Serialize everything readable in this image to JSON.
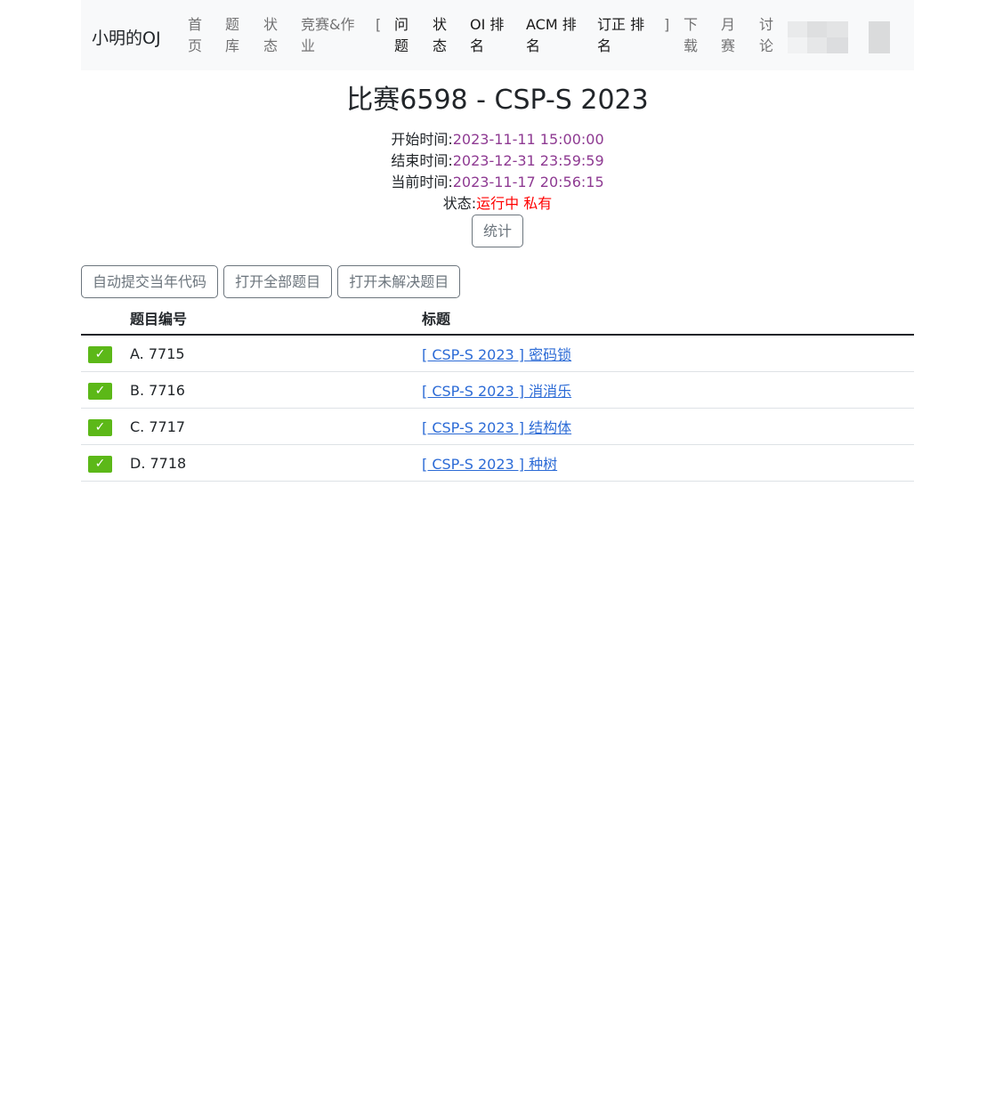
{
  "nav": {
    "brand": "小明的OJ",
    "items": [
      {
        "l1": "首",
        "l2": "页"
      },
      {
        "l1": "题",
        "l2": "库"
      },
      {
        "l1": "状",
        "l2": "态"
      },
      {
        "l1": "竞赛&作",
        "l2": "业"
      }
    ],
    "bracket_open": "[",
    "contest_items": [
      {
        "l1": "问",
        "l2": "题"
      },
      {
        "l1": "状",
        "l2": "态"
      },
      {
        "l1": "OI 排",
        "l2": "名"
      },
      {
        "l1": "ACM 排",
        "l2": "名"
      },
      {
        "l1": "订正 排",
        "l2": "名"
      }
    ],
    "bracket_close": "]",
    "right_items": [
      {
        "l1": "下",
        "l2": "载"
      },
      {
        "l1": "月",
        "l2": "赛"
      },
      {
        "l1": "讨",
        "l2": "论"
      }
    ]
  },
  "contest": {
    "title": "比赛6598 - CSP-S 2023",
    "start_label": "开始时间:",
    "start_time": "2023-11-11 15:00:00",
    "end_label": "结束时间:",
    "end_time": "2023-12-31 23:59:59",
    "now_label": "当前时间:",
    "now_time": "2023-11-17 20:56:15",
    "status_label": "状态:",
    "status_value": "运行中 私有",
    "stats_button": "统计"
  },
  "actions": {
    "auto_submit": "自动提交当年代码",
    "open_all": "打开全部题目",
    "open_unsolved": "打开未解决题目"
  },
  "table": {
    "headers": {
      "id": "题目编号",
      "title": "标题"
    },
    "rows": [
      {
        "check": "✓",
        "id": "A. 7715",
        "title": "[ CSP-S 2023 ] 密码锁"
      },
      {
        "check": "✓",
        "id": "B. 7716",
        "title": "[ CSP-S 2023 ] 消消乐"
      },
      {
        "check": "✓",
        "id": "C. 7717",
        "title": "[ CSP-S 2023 ] 结构体"
      },
      {
        "check": "✓",
        "id": "D. 7718",
        "title": "[ CSP-S 2023 ] 种树"
      }
    ]
  },
  "colors": {
    "info_value": "#8e3a92",
    "status_value": "#ff0000",
    "solved_badge": "#5cb818",
    "link": "#2c6bd6"
  }
}
